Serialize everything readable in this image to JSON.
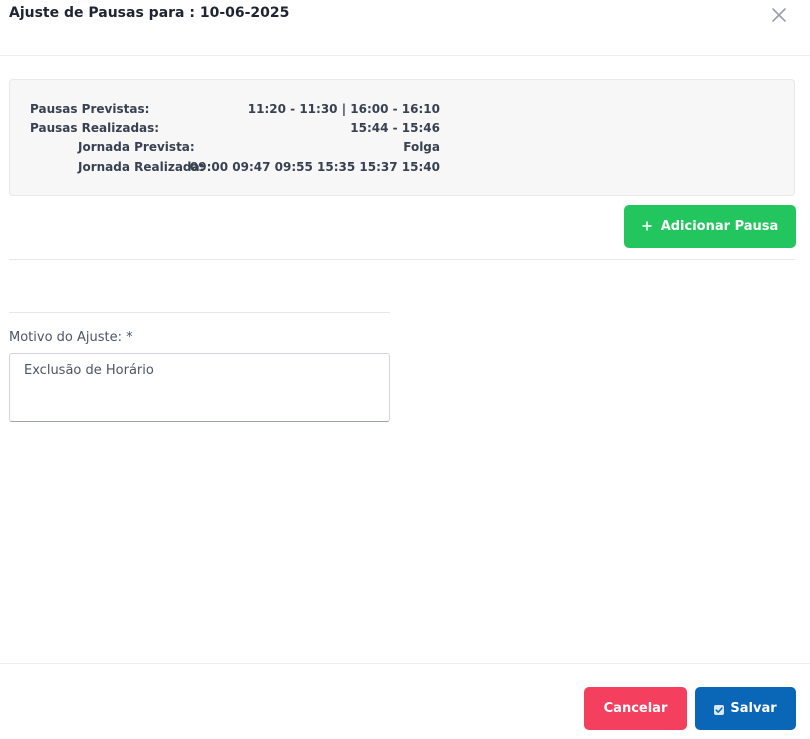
{
  "modal": {
    "title": "Ajuste de Pausas para : 10-06-2025",
    "close_icon": "close-icon"
  },
  "info": {
    "pausas_previstas_label": "Pausas Previstas:",
    "pausas_previstas_value": "11:20 - 11:30 | 16:00 - 16:10",
    "pausas_realizadas_label": "Pausas Realizadas:",
    "pausas_realizadas_value": "15:44 - 15:46",
    "jornada_prevista_label": "Jornada Prevista:",
    "jornada_prevista_value": "Folga",
    "jornada_realizada_label": "Jornada Realizada:",
    "jornada_realizada_value": "09:00 09:47 09:55 15:35 15:37 15:40"
  },
  "actions": {
    "add_pause_label": "Adicionar Pausa",
    "add_pause_icon": "plus-icon"
  },
  "form": {
    "motivo_label": "Motivo do Ajuste: *",
    "motivo_value": "Exclusão de Horário"
  },
  "footer": {
    "cancel_label": "Cancelar",
    "save_label": "Salvar",
    "save_icon": "check-square-icon"
  },
  "colors": {
    "add_button": "#22c55e",
    "cancel_button": "#f43f5e",
    "save_button": "#0a66b7",
    "panel_background": "#f7f7f8"
  }
}
